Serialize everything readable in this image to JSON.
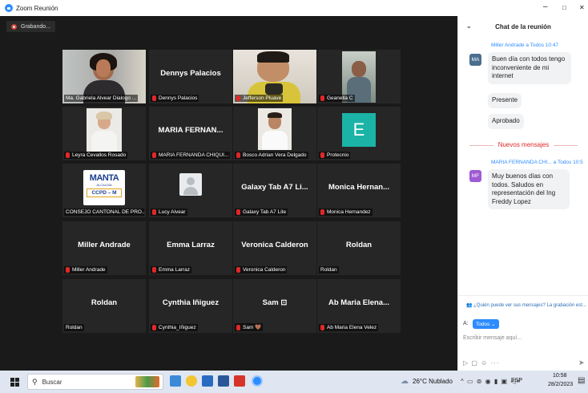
{
  "window": {
    "title": "Zoom Reunión",
    "minimize": "–",
    "maximize": "□",
    "close": "✕"
  },
  "recording": {
    "label": "Grabando..."
  },
  "tiles": [
    {
      "big": "",
      "label": "Ma. Gabriela Alvear Dialogo ..."
    },
    {
      "big": "Dennys Palacios",
      "label": "Dennys Palacios"
    },
    {
      "big": "",
      "label": "Jefferson Pluave"
    },
    {
      "big": "",
      "label": "Geanella C"
    },
    {
      "big": "",
      "label": "Leyra Cevallos Rosado"
    },
    {
      "big": "MARIA FERNAN...",
      "label": "MARIA FERNANDA CHIQUI..."
    },
    {
      "big": "",
      "label": "Bosco Adrian Vera Delgado"
    },
    {
      "big": "E",
      "label": "Protecnio"
    },
    {
      "big": "",
      "label": "CONSEJO CANTONAL DE PRO..."
    },
    {
      "big": "",
      "label": "Lucy Alvear"
    },
    {
      "big": "Galaxy Tab A7 Li...",
      "label": "Galaxy Tab A7 Lite"
    },
    {
      "big": "Monica Hernan...",
      "label": "Monica Hernandez"
    },
    {
      "big": "Miller Andrade",
      "label": "Miller Andrade"
    },
    {
      "big": "Emma Larraz",
      "label": "Emma Larraz"
    },
    {
      "big": "Veronica Calderon",
      "label": "Veronica Calderon"
    },
    {
      "big": "Roldan",
      "label": "Roldan"
    },
    {
      "big": "Roldan",
      "label": "Roldan"
    },
    {
      "big": "Cynthia Iñiguez",
      "label": "Cynthia_Iñiguez"
    },
    {
      "big": "Sam ⊡",
      "label": "Sam 🤎"
    },
    {
      "big": "Ab Maria Elena...",
      "label": "Ab Maria Elena Velez"
    }
  ],
  "logo": {
    "top": "MANTA",
    "sub": "ALCALDÍA",
    "bottom": "CCPD – M"
  },
  "chat": {
    "title": "Chat de la reunión",
    "messages": [
      {
        "initials": "MA",
        "sender": "Miller  Andrade  a Todos 10:47",
        "lines": [
          "Buen día con todos tengo",
          "inconveniente de mi",
          "internet"
        ]
      },
      {
        "text": "Presente"
      },
      {
        "text": "Aprobado"
      },
      {
        "initials": "MF",
        "sender": "MARIA FERNANDA CHI...  a Todos 10:5",
        "lines": [
          "Muy buenos días con",
          "todos. Saludos en",
          "representación del Ing",
          "Freddy Lopez"
        ]
      }
    ],
    "new_messages": "Nuevos mensajes",
    "who_can_see": "¿Quién puede ver sus mensajes? La grabación est...",
    "to_label": "A:",
    "to_value": "Todos ⌄",
    "placeholder": "Escribir mensaje aquí...",
    "tools": "▷ ▢ ☺ ···"
  },
  "taskbar": {
    "search": "Buscar",
    "weather": "26°C  Nublado",
    "lang": "ESP",
    "time": "10:58",
    "date": "28/2/2023",
    "tray": "^ ▭ ⊚ ◉ ▮ ▣ ◁× "
  }
}
